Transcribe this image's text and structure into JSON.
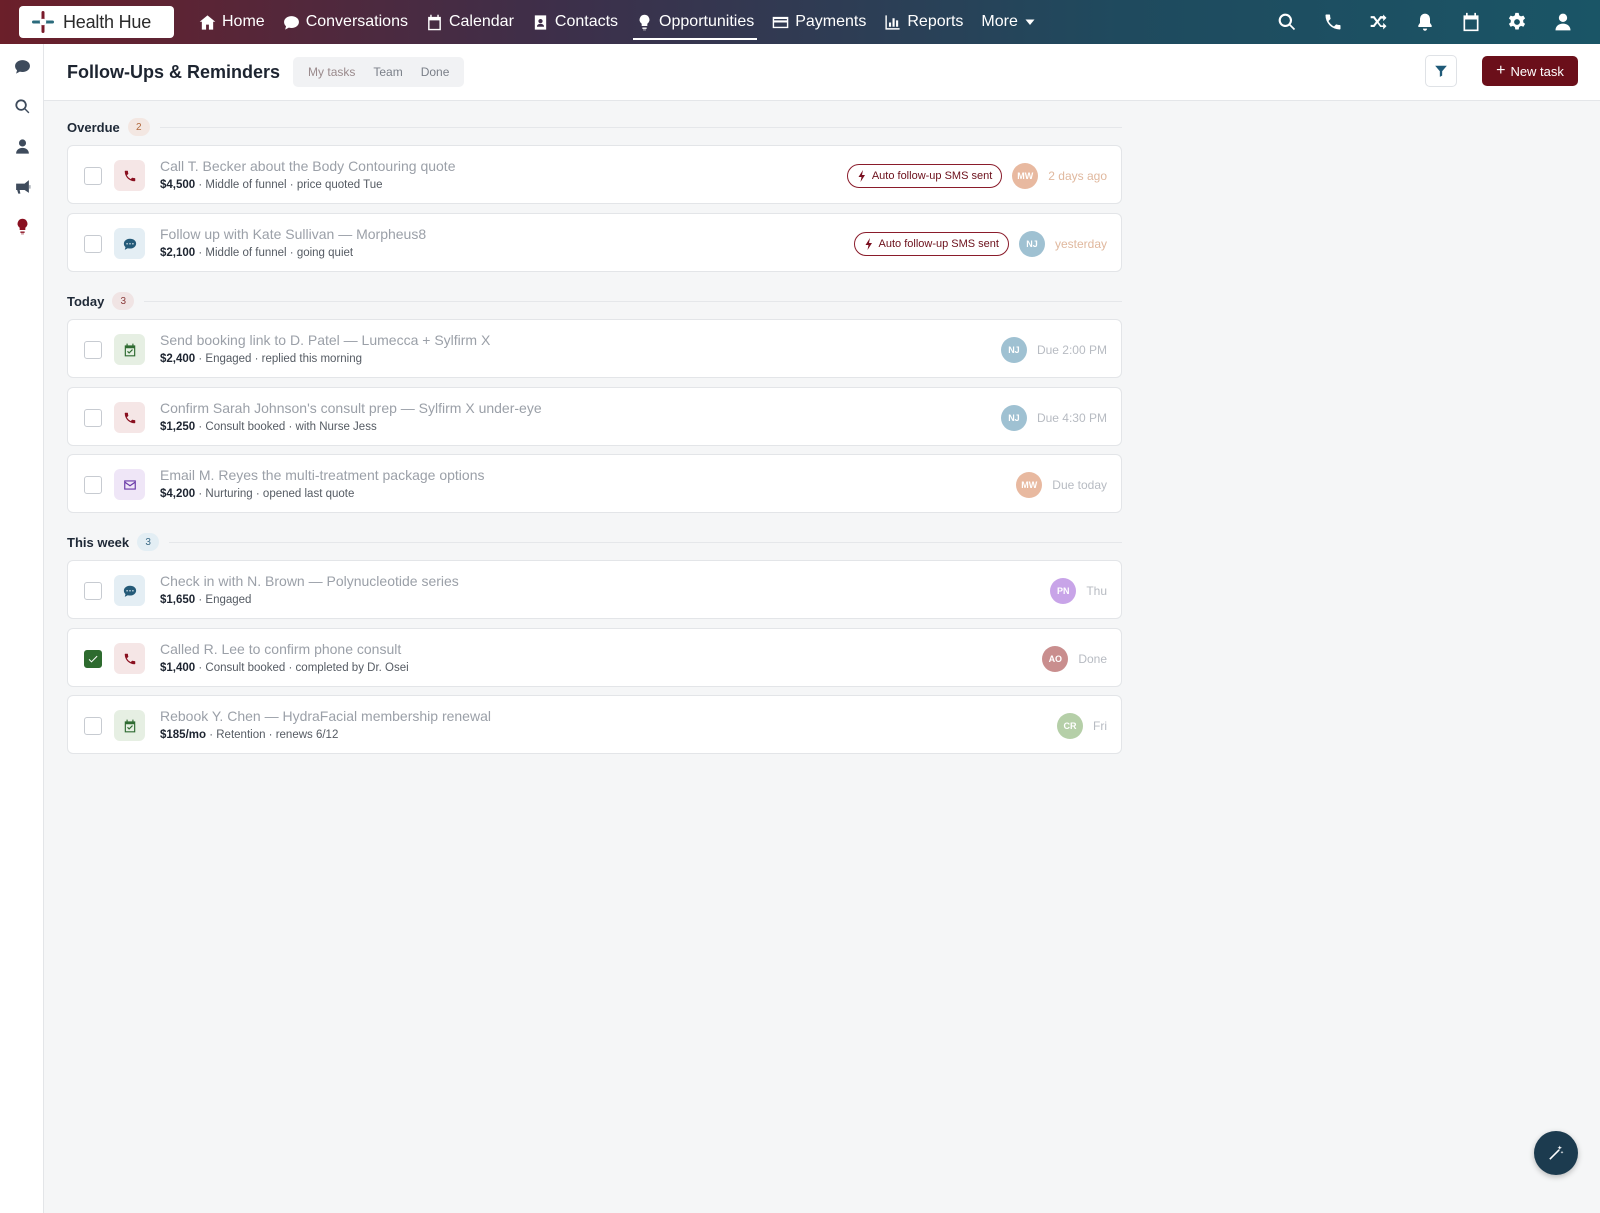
{
  "brand": {
    "name": "Health Hue"
  },
  "nav": {
    "items": [
      {
        "label": "Home",
        "icon": "home-icon"
      },
      {
        "label": "Conversations",
        "icon": "chat-icon"
      },
      {
        "label": "Calendar",
        "icon": "calendar-icon"
      },
      {
        "label": "Contacts",
        "icon": "contact-card-icon"
      },
      {
        "label": "Opportunities",
        "icon": "lightbulb-icon",
        "active": true
      },
      {
        "label": "Payments",
        "icon": "credit-card-icon"
      },
      {
        "label": "Reports",
        "icon": "bar-chart-icon"
      },
      {
        "label": "More",
        "icon": "caret-down-icon"
      }
    ],
    "right_icons": [
      "search-icon",
      "phone-icon",
      "shuffle-icon",
      "bell-icon",
      "calendar-icon",
      "gear-icon",
      "user-icon"
    ]
  },
  "rail": {
    "icons": [
      "chat-icon",
      "search-icon",
      "user-icon",
      "megaphone-icon",
      "lightbulb-icon"
    ]
  },
  "header": {
    "title": "Follow-Ups & Reminders",
    "tabs": [
      {
        "label": "My tasks",
        "active": true
      },
      {
        "label": "Team",
        "active": false
      },
      {
        "label": "Done",
        "active": false
      }
    ],
    "new_task_label": "New task"
  },
  "sections": [
    {
      "title": "Overdue",
      "count": "2",
      "tasks": [
        {
          "title": "Call T. Becker about the Body Contouring quote",
          "amount": "$4,500",
          "detail": " · Middle of funnel · price quoted Tue",
          "type": "call",
          "pill": "Auto follow-up SMS sent",
          "avatar": "MW",
          "due": "2 days ago",
          "checked": false
        },
        {
          "title": "Follow up with Kate Sullivan — Morpheus8",
          "amount": "$2,100",
          "detail": " · Middle of funnel · going quiet",
          "type": "message",
          "pill": "Auto follow-up SMS sent",
          "avatar": "NJ",
          "due": "yesterday",
          "checked": false
        }
      ]
    },
    {
      "title": "Today",
      "count": "3",
      "tasks": [
        {
          "title": "Send booking link to D. Patel — Lumecca + Sylfirm X",
          "amount": "$2,400",
          "detail": " · Engaged · replied this morning",
          "type": "calendar",
          "pill": "",
          "avatar": "NJ",
          "due": "Due 2:00 PM",
          "checked": false
        },
        {
          "title": "Confirm Sarah Johnson's consult prep — Sylfirm X under-eye",
          "amount": "$1,250",
          "detail": " · Consult booked · with Nurse Jess",
          "type": "call",
          "pill": "",
          "avatar": "NJ",
          "due": "Due 4:30 PM",
          "checked": false
        },
        {
          "title": "Email M. Reyes the multi-treatment package options",
          "amount": "$4,200",
          "detail": " · Nurturing · opened last quote",
          "type": "email",
          "pill": "",
          "avatar": "MW",
          "due": "Due today",
          "checked": false
        }
      ]
    },
    {
      "title": "This week",
      "count": "3",
      "tasks": [
        {
          "title": "Check in with N. Brown — Polynucleotide series",
          "amount": "$1,650",
          "detail": " · Engaged",
          "type": "message",
          "pill": "",
          "avatar": "PN",
          "due": "Thu",
          "checked": false
        },
        {
          "title": "Called R. Lee to confirm phone consult",
          "amount": "$1,400",
          "detail": " · Consult booked · completed by Dr. Osei",
          "type": "call",
          "pill": "",
          "avatar": "AO",
          "due": "Done",
          "checked": true
        },
        {
          "title": "Rebook Y. Chen — HydraFacial membership renewal",
          "amount": "$185/mo",
          "detail": " · Retention · renews 6/12",
          "type": "calendar",
          "pill": "",
          "avatar": "CR",
          "due": "Fri",
          "checked": false
        }
      ]
    }
  ],
  "colors": {
    "accent": "#6b0f1a",
    "overdue_count_bg": "#f3e7e2",
    "today_count_bg": "#f0e4e4",
    "week_count_bg": "#e3eef4",
    "avatar_MW": "#e8b9a0",
    "avatar_NJ": "#9fc1d2",
    "avatar_PN": "#c8a4e8",
    "avatar_AO": "#c98e8e",
    "avatar_CR": "#b5cfa8"
  }
}
